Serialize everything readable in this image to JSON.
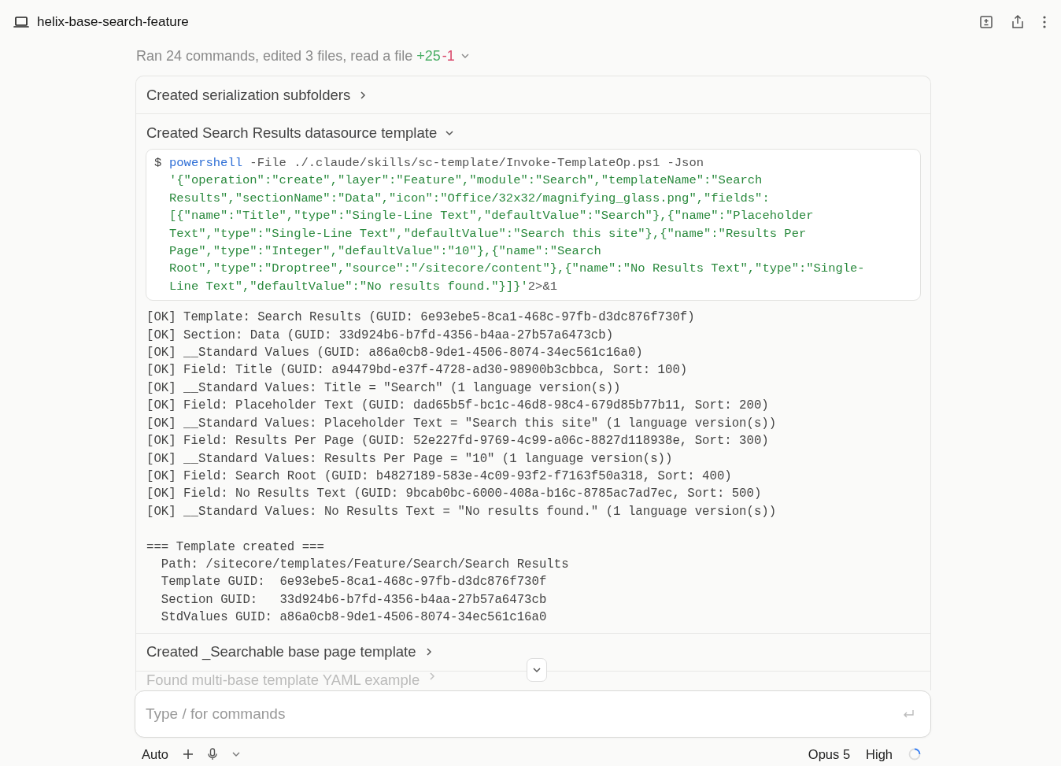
{
  "header": {
    "title": "helix-base-search-feature"
  },
  "summary": {
    "text": "Ran 24 commands, edited 3 files, read a file",
    "added": "+25",
    "removed": "-1",
    "expanded": false
  },
  "steps": [
    {
      "title": "Created serialization subfolders",
      "expanded": false
    },
    {
      "title": "Created Search Results datasource template",
      "expanded": true,
      "command": {
        "prompt": "$",
        "program": "powershell",
        "args": "-File ./.claude/skills/sc-template/Invoke-TemplateOp.ps1 -Json",
        "json_lines": [
          "'{\"operation\":\"create\",\"layer\":\"Feature\",\"module\":\"Search\",\"templateName\":\"Search",
          "Results\",\"sectionName\":\"Data\",\"icon\":\"Office/32x32/magnifying_glass.png\",\"fields\":",
          "[{\"name\":\"Title\",\"type\":\"Single-Line Text\",\"defaultValue\":\"Search\"},{\"name\":\"Placeholder",
          "Text\",\"type\":\"Single-Line Text\",\"defaultValue\":\"Search this site\"},{\"name\":\"Results Per",
          "Page\",\"type\":\"Integer\",\"defaultValue\":\"10\"},{\"name\":\"Search",
          "Root\",\"type\":\"Droptree\",\"source\":\"/sitecore/content\"},{\"name\":\"No Results Text\",\"type\":\"Single-",
          "Line Text\",\"defaultValue\":\"No results found.\"}]}'"
        ],
        "redirect": "2>&1"
      },
      "output_lines": [
        "[OK] Template: Search Results (GUID: 6e93ebe5-8ca1-468c-97fb-d3dc876f730f)",
        "[OK] Section: Data (GUID: 33d924b6-b7fd-4356-b4aa-27b57a6473cb)",
        "[OK] __Standard Values (GUID: a86a0cb8-9de1-4506-8074-34ec561c16a0)",
        "[OK] Field: Title (GUID: a94479bd-e37f-4728-ad30-98900b3cbbca, Sort: 100)",
        "[OK] __Standard Values: Title = \"Search\" (1 language version(s))",
        "[OK] Field: Placeholder Text (GUID: dad65b5f-bc1c-46d8-98c4-679d85b77b11, Sort: 200)",
        "[OK] __Standard Values: Placeholder Text = \"Search this site\" (1 language version(s))",
        "[OK] Field: Results Per Page (GUID: 52e227fd-9769-4c99-a06c-8827d118938e, Sort: 300)",
        "[OK] __Standard Values: Results Per Page = \"10\" (1 language version(s))",
        "[OK] Field: Search Root (GUID: b4827189-583e-4c09-93f2-f7163f50a318, Sort: 400)",
        "[OK] Field: No Results Text (GUID: 9bcab0bc-6000-408a-b16c-8785ac7ad7ec, Sort: 500)",
        "[OK] __Standard Values: No Results Text = \"No results found.\" (1 language version(s))"
      ],
      "summary_lines": [
        "=== Template created ===",
        "  Path: /sitecore/templates/Feature/Search/Search Results",
        "  Template GUID:  6e93ebe5-8ca1-468c-97fb-d3dc876f730f",
        "  Section GUID:   33d924b6-b7fd-4356-b4aa-27b57a6473cb",
        "  StdValues GUID: a86a0cb8-9de1-4506-8074-34ec561c16a0"
      ]
    },
    {
      "title": "Created _Searchable base page template",
      "expanded": false
    },
    {
      "title": "Found multi-base template YAML example",
      "expanded": false
    }
  ],
  "composer": {
    "placeholder": "Type / for commands"
  },
  "footer": {
    "mode": "Auto",
    "model": "Opus 5",
    "effort": "High"
  }
}
